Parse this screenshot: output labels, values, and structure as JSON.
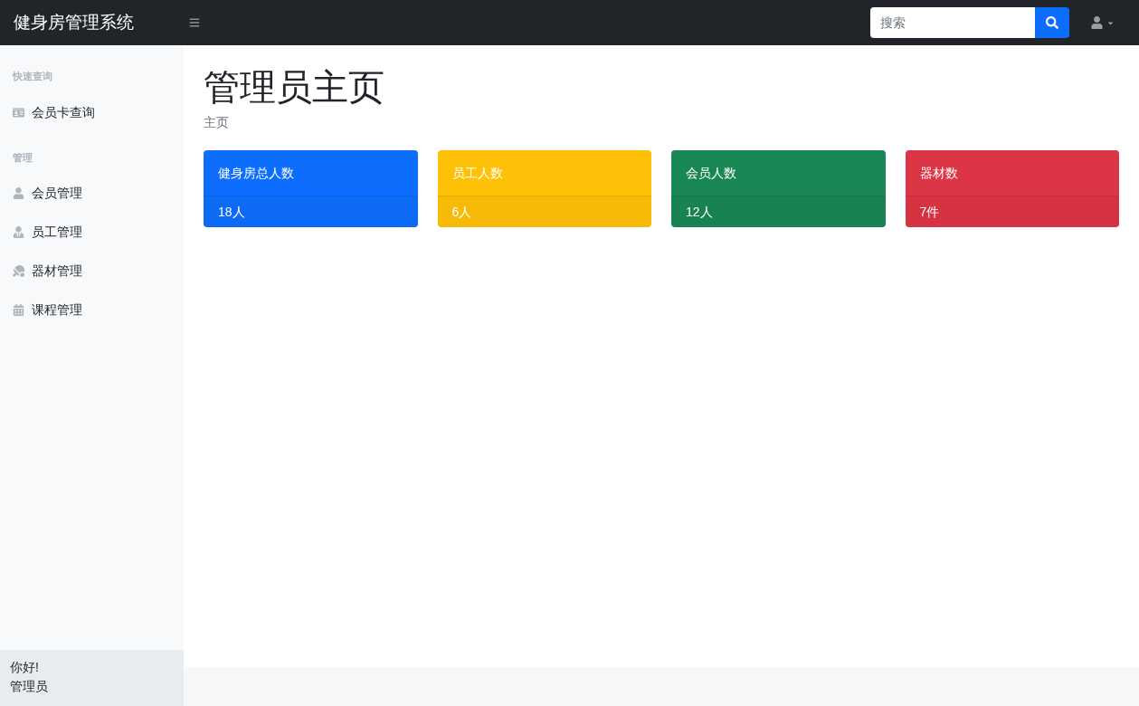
{
  "brand": "健身房管理系统",
  "search": {
    "placeholder": "搜索"
  },
  "sidebar": {
    "sections": [
      {
        "heading": "快速查询",
        "items": [
          {
            "label": "会员卡查询",
            "kind": "card"
          }
        ]
      },
      {
        "heading": "管理",
        "items": [
          {
            "label": "会员管理",
            "kind": "user"
          },
          {
            "label": "员工管理",
            "kind": "staff"
          },
          {
            "label": "器材管理",
            "kind": "equipment"
          },
          {
            "label": "课程管理",
            "kind": "calendar"
          }
        ]
      }
    ],
    "footer": {
      "greeting": "你好!",
      "user": "管理员"
    }
  },
  "page": {
    "title": "管理员主页",
    "breadcrumb": "主页"
  },
  "cards": [
    {
      "title": "健身房总人数",
      "value": "18人",
      "color": "#0d6efd"
    },
    {
      "title": "员工人数",
      "value": "6人",
      "color": "#ffc107"
    },
    {
      "title": "会员人数",
      "value": "12人",
      "color": "#198754"
    },
    {
      "title": "器材数",
      "value": "7件",
      "color": "#dc3545"
    }
  ]
}
